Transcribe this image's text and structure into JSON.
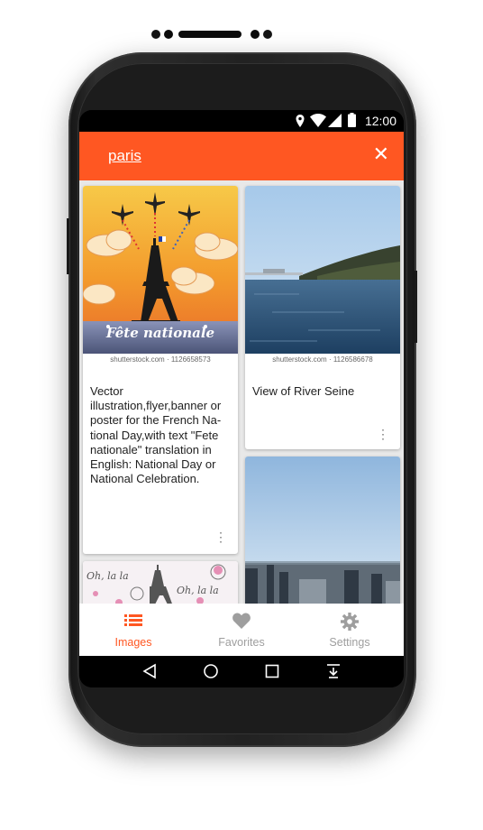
{
  "statusbar": {
    "time": "12:00"
  },
  "search": {
    "query": "paris"
  },
  "cards": [
    {
      "credit": "shutterstock.com · 1126658573",
      "caption": "Vector illustration,flyer,banner or poster for the French Na-tional Day,with text \"Fete nationale\" translation in English: National Day or National Celebration.",
      "image_text": "Fête nationale"
    },
    {
      "credit": "shutterstock.com · 1126586678",
      "caption": "View of River Seine"
    },
    {
      "image_text": "Oh, la la"
    },
    {}
  ],
  "bottom_nav": {
    "items": [
      {
        "label": "Images",
        "icon": "list-icon",
        "active": true
      },
      {
        "label": "Favorites",
        "icon": "heart-icon",
        "active": false
      },
      {
        "label": "Settings",
        "icon": "gear-icon",
        "active": false
      }
    ]
  },
  "colors": {
    "accent": "#ff5722",
    "inactive": "#9e9e9e",
    "background": "#e8e8e8"
  },
  "system_nav": [
    "back-icon",
    "home-icon",
    "recents-icon",
    "notification-shade-icon"
  ]
}
